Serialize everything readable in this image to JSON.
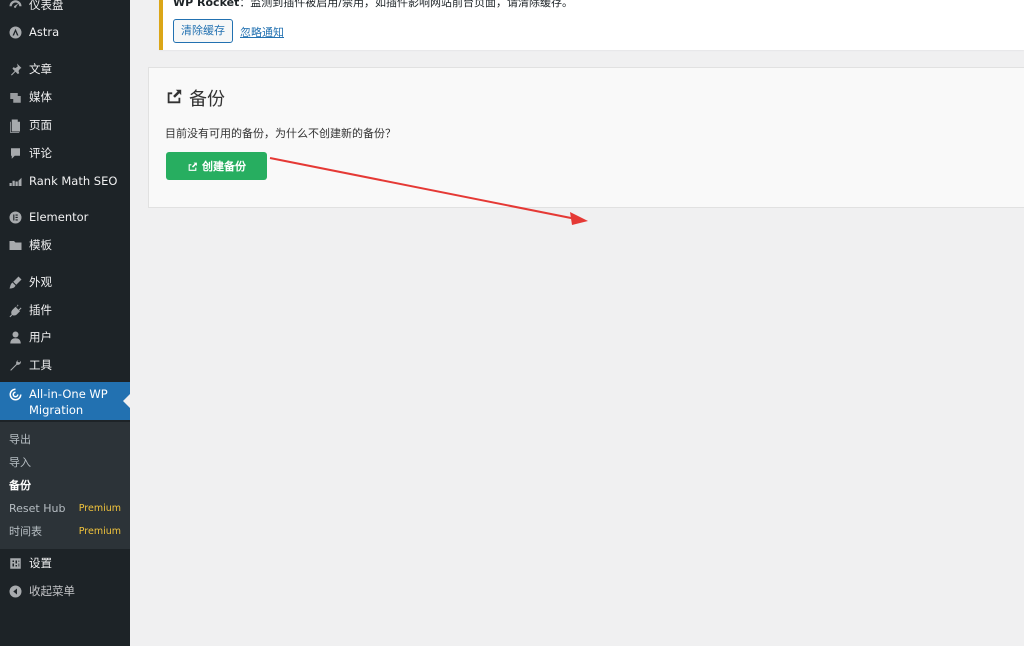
{
  "sidebar": {
    "items": [
      {
        "label": "仪表盘",
        "icon": "dashboard-icon"
      },
      {
        "label": "Astra",
        "icon": "astra-icon"
      },
      {
        "label": "文章",
        "icon": "pin-icon"
      },
      {
        "label": "媒体",
        "icon": "media-icon"
      },
      {
        "label": "页面",
        "icon": "page-icon"
      },
      {
        "label": "评论",
        "icon": "comment-icon"
      },
      {
        "label": "Rank Math SEO",
        "icon": "rank-math-icon"
      },
      {
        "label": "Elementor",
        "icon": "elementor-icon"
      },
      {
        "label": "模板",
        "icon": "folder-icon"
      },
      {
        "label": "外观",
        "icon": "brush-icon"
      },
      {
        "label": "插件",
        "icon": "plugin-icon"
      },
      {
        "label": "用户",
        "icon": "user-icon"
      },
      {
        "label": "工具",
        "icon": "wrench-icon"
      },
      {
        "label": "All-in-One WP Migration",
        "icon": "migration-icon"
      },
      {
        "label": "设置",
        "icon": "settings-icon"
      },
      {
        "label": "收起菜单",
        "icon": "collapse-icon"
      }
    ],
    "submenu": [
      {
        "label": "导出"
      },
      {
        "label": "导入"
      },
      {
        "label": "备份"
      },
      {
        "label": "Reset Hub",
        "badge": "Premium"
      },
      {
        "label": "时间表",
        "badge": "Premium"
      }
    ]
  },
  "notice": {
    "brand": "WP Rocket",
    "text": "：监测到插件被启用/禁用，如插件影响网站前台页面，请清除缓存。",
    "clear_button": "清除缓存",
    "dismiss_link": "忽略通知"
  },
  "backups": {
    "title": "备份",
    "description": "目前没有可用的备份，为什么不创建新的备份？",
    "create_button": "创建备份"
  },
  "colors": {
    "sidebar_bg": "#1d2327",
    "active_blue": "#2271b1",
    "create_green": "#27ae60",
    "premium_yellow": "#f0c33c",
    "arrow_red": "#e53935"
  }
}
